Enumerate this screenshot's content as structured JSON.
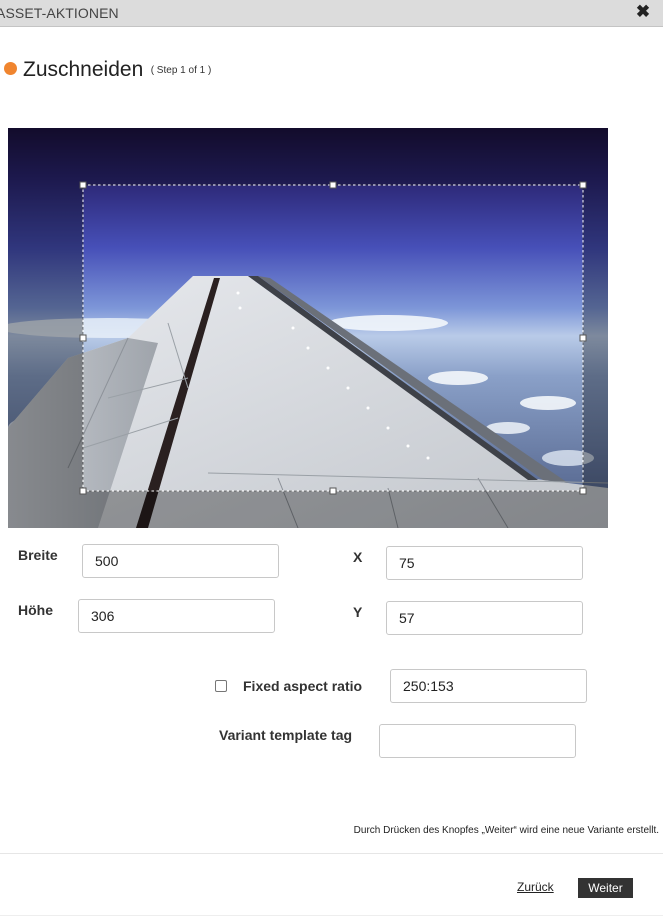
{
  "window": {
    "title": "ASSET-AKTIONEN",
    "close_icon": "close-icon"
  },
  "step": {
    "title": "Zuschneiden",
    "subtitle": "( Step 1 of 1 )",
    "indicator_color": "#f0852f"
  },
  "image": {
    "description_icon": "image-preview"
  },
  "crop": {
    "width_label": "Breite",
    "width_value": "500",
    "height_label": "Höhe",
    "height_value": "306",
    "x_label": "X",
    "x_value": "75",
    "y_label": "Y",
    "y_value": "57",
    "fixed_ratio_label": "Fixed aspect ratio",
    "fixed_ratio_checked": false,
    "ratio_value": "250:153",
    "variant_tag_label": "Variant template tag",
    "variant_tag_value": ""
  },
  "footer": {
    "note": "Durch Drücken des Knopfes „Weiter“ wird eine neue Variante erstellt.",
    "back_label": "Zurück",
    "next_label": "Weiter",
    "next_button_color": "#333333"
  }
}
